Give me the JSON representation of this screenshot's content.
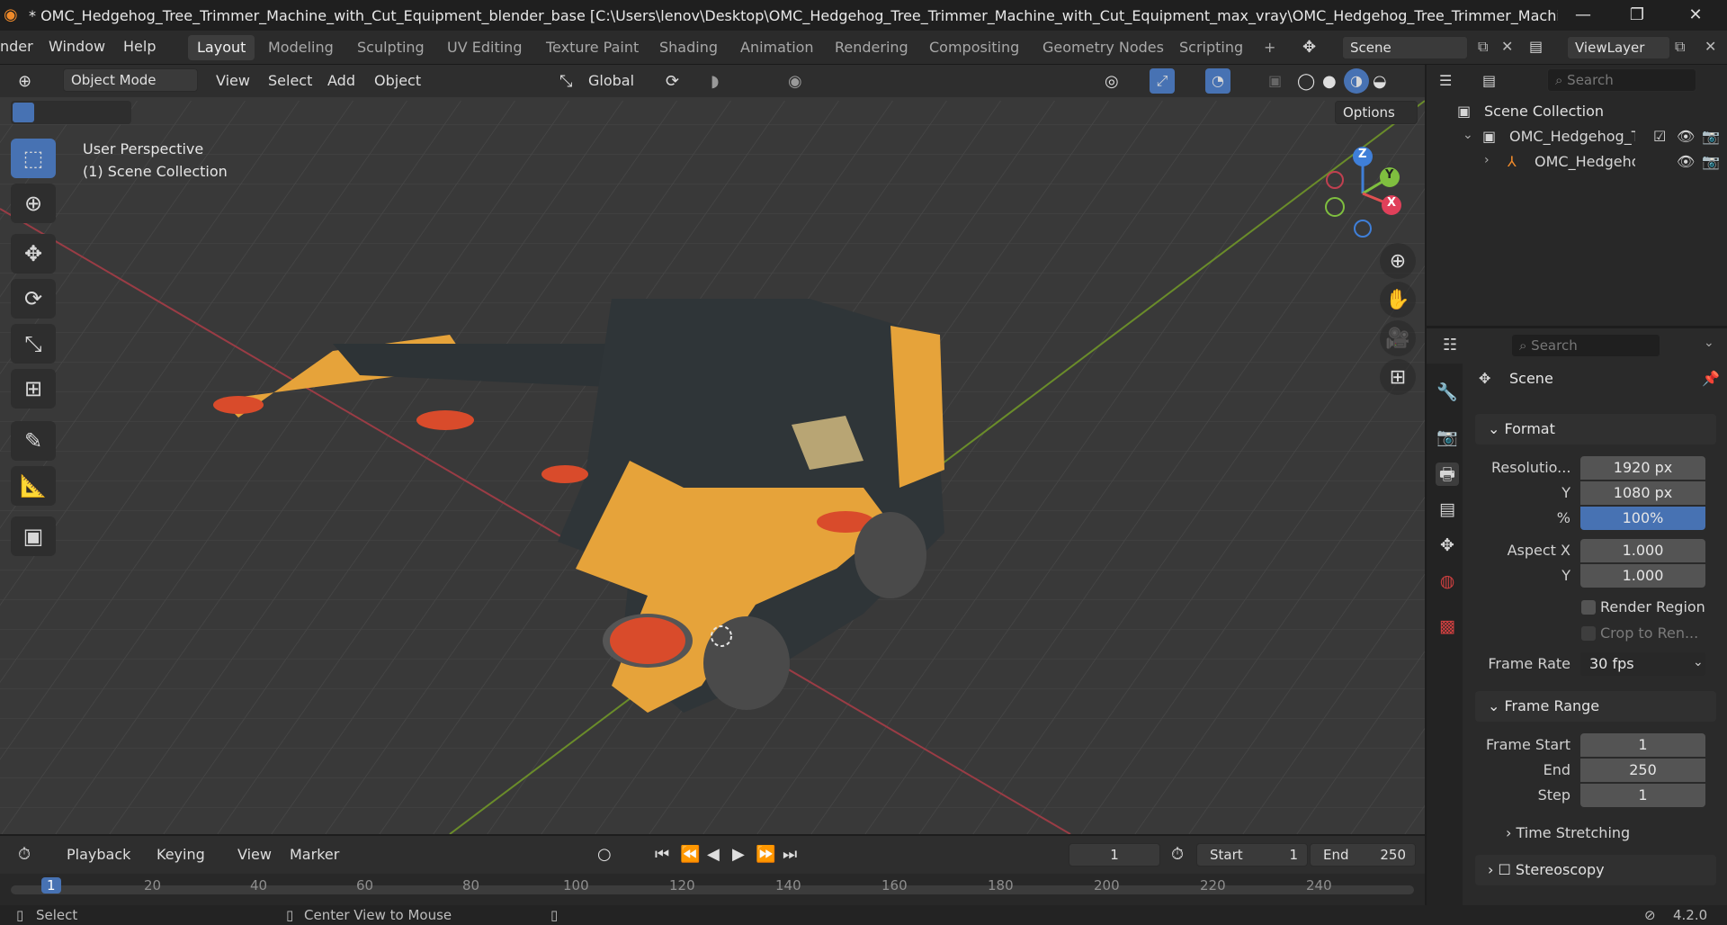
{
  "window": {
    "title": "* OMC_Hedgehog_Tree_Trimmer_Machine_with_Cut_Equipment_blender_base [C:\\Users\\lenov\\Desktop\\OMC_Hedgehog_Tree_Trimmer_Machine_with_Cut_Equipment_max_vray\\OMC_Hedgehog_Tree_Trimmer_Machine_with...",
    "minimize": "—",
    "maximize": "❐",
    "close": "✕"
  },
  "menu": {
    "render": "nder",
    "window": "Window",
    "help": "Help"
  },
  "workspaces": [
    "Layout",
    "Modeling",
    "Sculpting",
    "UV Editing",
    "Texture Paint",
    "Shading",
    "Animation",
    "Rendering",
    "Compositing",
    "Geometry Nodes",
    "Scripting",
    "+"
  ],
  "scene": {
    "name": "Scene",
    "viewlayer": "ViewLayer"
  },
  "viewport_header": {
    "mode": "Object Mode",
    "view": "View",
    "select": "Select",
    "add": "Add",
    "object": "Object",
    "orientation": "Global",
    "options": "Options"
  },
  "viewport": {
    "perspective": "User Perspective",
    "collection": "(1) Scene Collection"
  },
  "gizmo": {
    "z": "Z",
    "y": "Y",
    "x": "X"
  },
  "outliner": {
    "search_placeholder": "Search",
    "scene_collection": "Scene Collection",
    "item1": "OMC_Hedgehog_Tr",
    "item2": "OMC_Hedgeho"
  },
  "properties": {
    "search_placeholder": "Search",
    "context": "Scene",
    "format_panel": "Format",
    "res_label": "Resolutio...",
    "res_x": "1920 px",
    "y_label": "Y",
    "res_y": "1080 px",
    "pct_label": "%",
    "pct": "100%",
    "aspect_label": "Aspect X",
    "aspect_x": "1.000",
    "aspect_y_label": "Y",
    "aspect_y": "1.000",
    "render_region": "Render Region",
    "crop": "Crop to Ren...",
    "frame_rate_label": "Frame Rate",
    "frame_rate": "30 fps",
    "frame_range_panel": "Frame Range",
    "fs_label": "Frame Start",
    "fs": "1",
    "end_label": "End",
    "end": "250",
    "step_label": "Step",
    "step": "1",
    "time_stretching": "Time Stretching",
    "stereoscopy": "Stereoscopy"
  },
  "timeline": {
    "playback": "Playback",
    "keying": "Keying",
    "view": "View",
    "marker": "Marker",
    "current_frame": "1",
    "start_label": "Start",
    "start": "1",
    "end_label": "End",
    "end": "250",
    "ticks": [
      "1",
      "20",
      "40",
      "60",
      "80",
      "100",
      "120",
      "140",
      "160",
      "180",
      "200",
      "220",
      "240"
    ]
  },
  "status": {
    "select": "Select",
    "center": "Center View to Mouse",
    "version": "4.2.0"
  },
  "colors": {
    "accent": "#4772b3",
    "orange": "#ef8a2a",
    "machine_yellow": "#e6a33a"
  }
}
